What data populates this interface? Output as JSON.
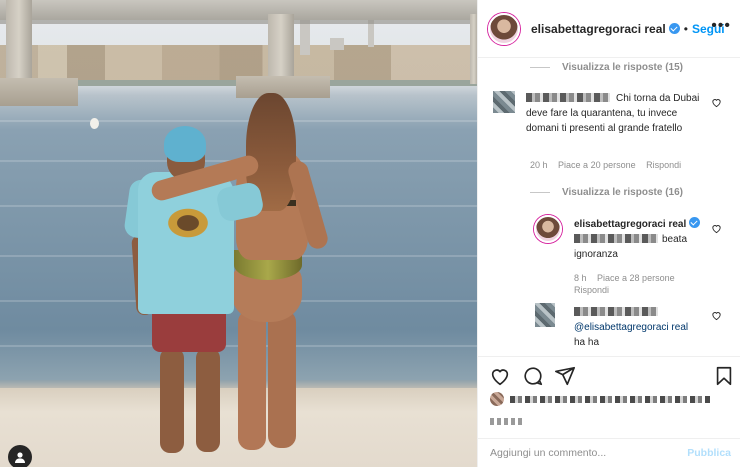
{
  "post": {
    "username": "elisabettagregoraci real",
    "follow_label": "Segui",
    "dot": "•",
    "more_label": "•••"
  },
  "comments": {
    "view_replies_1": "Visualizza le risposte (15)",
    "comment_1_text": "Chi torna da Dubai deve fare la quarantena, tu invece domani ti presenti al grande fratello",
    "comment_1_time": "20 h",
    "comment_1_likes": "Piace a 20 persone",
    "comment_1_reply": "Rispondi",
    "view_replies_2": "Visualizza le risposte (16)",
    "reply_1_user": "elisabettagregoraci real",
    "reply_1_text": "beata ignoranza",
    "reply_1_time": "8 h",
    "reply_1_likes": "Piace a 28 persone",
    "reply_1_reply": "Rispondi",
    "reply_2_mention": "@elisabettagregoraci real",
    "reply_2_text": "ha ha"
  },
  "composer": {
    "placeholder": "Aggiungi un commento...",
    "publish_label": "Pubblica"
  },
  "colors": {
    "link_blue": "#0095f6",
    "verified_blue": "#3897f0",
    "publish_disabled": "#b2dffc"
  },
  "icons": [
    "heart-icon",
    "comment-icon",
    "share-icon",
    "bookmark-icon",
    "user-tag-icon",
    "verified-icon",
    "more-icon"
  ]
}
